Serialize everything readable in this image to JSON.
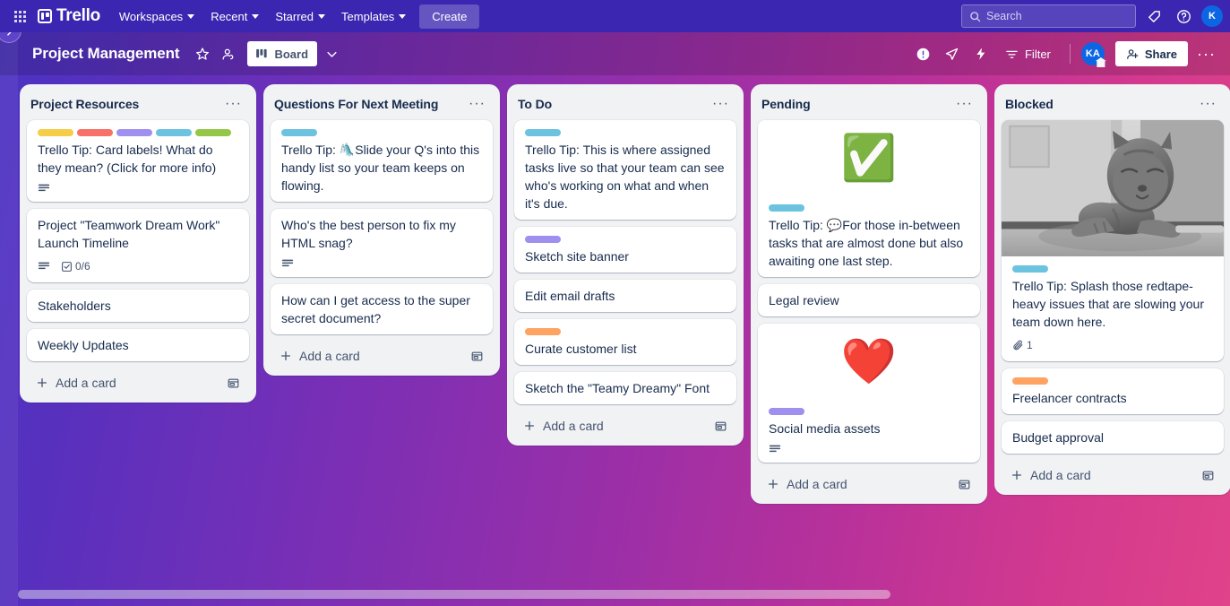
{
  "topnav": {
    "apps_icon": "grid-apps-icon",
    "logo_text": "Trello",
    "items": [
      {
        "label": "Workspaces",
        "has_chevron": true
      },
      {
        "label": "Recent",
        "has_chevron": true
      },
      {
        "label": "Starred",
        "has_chevron": true
      },
      {
        "label": "Templates",
        "has_chevron": true
      }
    ],
    "create_label": "Create",
    "search": {
      "placeholder": "Search",
      "value": "",
      "icon": "search-icon"
    },
    "notifications_icon": "notification-bell-icon",
    "help_icon": "help-circle-icon",
    "avatar_initial": "K"
  },
  "board_header": {
    "title": "Project Management",
    "star_icon": "star-icon",
    "visibility_icon": "workspace-visible-icon",
    "view_label": "Board",
    "view_icon": "board-view-icon",
    "view_chevron_icon": "chevron-down-icon",
    "info_icon": "info-circle-icon",
    "rocket_icon": "send-plane-icon",
    "automation_icon": "lightning-bolt-icon",
    "filter_label": "Filter",
    "filter_icon": "filter-icon",
    "member_initials": "KA",
    "share_label": "Share",
    "share_icon": "person-add-icon",
    "more_icon": "more-horizontal-icon",
    "sidebar_toggle_icon": "chevron-right-icon"
  },
  "label_colors": {
    "yellow": "#f5cd47",
    "red": "#f87168",
    "purple": "#9f8fef",
    "blue": "#6cc3e0",
    "green": "#94c748",
    "orange": "#fea362"
  },
  "add_card_label": "Add a card",
  "lists": [
    {
      "title": "Project Resources",
      "cards": [
        {
          "title": "Trello Tip: Card labels! What do they mean? (Click for more info)",
          "labels": [
            "yellow",
            "red",
            "purple",
            "blue",
            "green"
          ],
          "badges": {
            "description": true
          }
        },
        {
          "title": "Project \"Teamwork Dream Work\" Launch Timeline",
          "labels": [],
          "badges": {
            "description": true,
            "checklist": "0/6"
          }
        },
        {
          "title": "Stakeholders",
          "labels": [],
          "badges": {}
        },
        {
          "title": "Weekly Updates",
          "labels": [],
          "badges": {}
        }
      ]
    },
    {
      "title": "Questions For Next Meeting",
      "cards": [
        {
          "title": "Trello Tip: 🛝Slide your Q's into this handy list so your team keeps on flowing.",
          "labels": [
            "blue"
          ],
          "badges": {}
        },
        {
          "title": "Who's the best person to fix my HTML snag?",
          "labels": [],
          "badges": {
            "description": true
          }
        },
        {
          "title": "How can I get access to the super secret document?",
          "labels": [],
          "badges": {}
        }
      ]
    },
    {
      "title": "To Do",
      "cards": [
        {
          "title": "Trello Tip: This is where assigned tasks live so that your team can see who's working on what and when it's due.",
          "labels": [
            "blue"
          ],
          "badges": {}
        },
        {
          "title": "Sketch site banner",
          "labels": [
            "purple"
          ],
          "badges": {}
        },
        {
          "title": "Edit email drafts",
          "labels": [],
          "badges": {}
        },
        {
          "title": "Curate customer list",
          "labels": [
            "orange"
          ],
          "badges": {}
        },
        {
          "title": "Sketch the \"Teamy Dreamy\" Font",
          "labels": [],
          "badges": {}
        }
      ]
    },
    {
      "title": "Pending",
      "cards": [
        {
          "title": "Trello Tip: 💬For those in-between tasks that are almost done but also awaiting one last step.",
          "labels": [
            "blue"
          ],
          "badges": {},
          "cover": {
            "type": "emoji",
            "glyph": "✅"
          }
        },
        {
          "title": "Legal review",
          "labels": [],
          "badges": {}
        },
        {
          "title": "Social media assets",
          "labels": [
            "purple"
          ],
          "badges": {
            "description": true
          },
          "cover": {
            "type": "emoji",
            "glyph": "❤️"
          }
        }
      ]
    },
    {
      "title": "Blocked",
      "cards": [
        {
          "title": "Trello Tip: Splash those redtape-heavy issues that are slowing your team down here.",
          "labels": [
            "blue"
          ],
          "badges": {
            "attachments": "1"
          },
          "cover": {
            "type": "image",
            "alt": "grayscale photo of a sad cat sitting in a corner"
          }
        },
        {
          "title": "Freelancer contracts",
          "labels": [
            "orange"
          ],
          "badges": {}
        },
        {
          "title": "Budget approval",
          "labels": [],
          "badges": {}
        }
      ]
    }
  ]
}
